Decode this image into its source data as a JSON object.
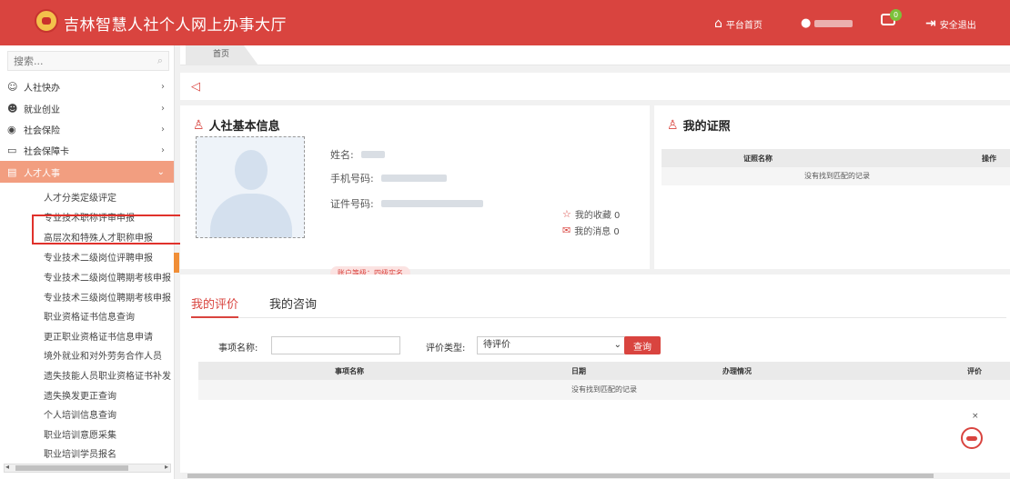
{
  "header": {
    "app_title": "吉林智慧人社个人网上办事大厅",
    "home_link": "平台首页",
    "message_count": "0",
    "logout": "安全退出"
  },
  "sidebar": {
    "search_placeholder": "搜索...",
    "menu": [
      {
        "label": "人社快办",
        "icon": "person-icon"
      },
      {
        "label": "就业创业",
        "icon": "people-icon"
      },
      {
        "label": "社会保险",
        "icon": "shield-icon"
      },
      {
        "label": "社会保障卡",
        "icon": "card-icon"
      },
      {
        "label": "人才人事",
        "icon": "document-icon",
        "active": true
      }
    ],
    "submenu": [
      "人才分类定级评定",
      "专业技术职称评审申报",
      "高层次和特殊人才职称申报",
      "专业技术二级岗位评聘申报",
      "专业技术二级岗位聘期考核申报",
      "专业技术三级岗位聘期考核申报",
      "职业资格证书信息查询",
      "更正职业资格证书信息申请",
      "境外就业和对外劳务合作人员",
      "遗失技能人员职业资格证书补发",
      "遗失换发更正查询",
      "个人培训信息查询",
      "职业培训意愿采集",
      "职业培训学员报名"
    ]
  },
  "tabs": {
    "home": "首页"
  },
  "basic_info": {
    "title": "人社基本信息",
    "name_label": "姓名:",
    "phone_label": "手机号码:",
    "id_label": "证件号码:",
    "account_level": "账户等级：四级实名",
    "favorites": "我的收藏 0",
    "messages": "我的消息 0"
  },
  "certificates": {
    "title": "我的证照",
    "columns": [
      "证照名称",
      "操作"
    ],
    "empty": "没有找到匹配的记录"
  },
  "evaluation": {
    "tabs": [
      "我的评价",
      "我的咨询"
    ],
    "item_name_label": "事项名称:",
    "item_name_value": "",
    "type_label": "评价类型:",
    "type_value": "待评价",
    "query_button": "查询",
    "columns": [
      "事项名称",
      "日期",
      "办理情况",
      "评价"
    ],
    "empty": "没有找到匹配的记录"
  },
  "colors": {
    "brand_red": "#d9443f",
    "active_menu": "#f29e80"
  }
}
